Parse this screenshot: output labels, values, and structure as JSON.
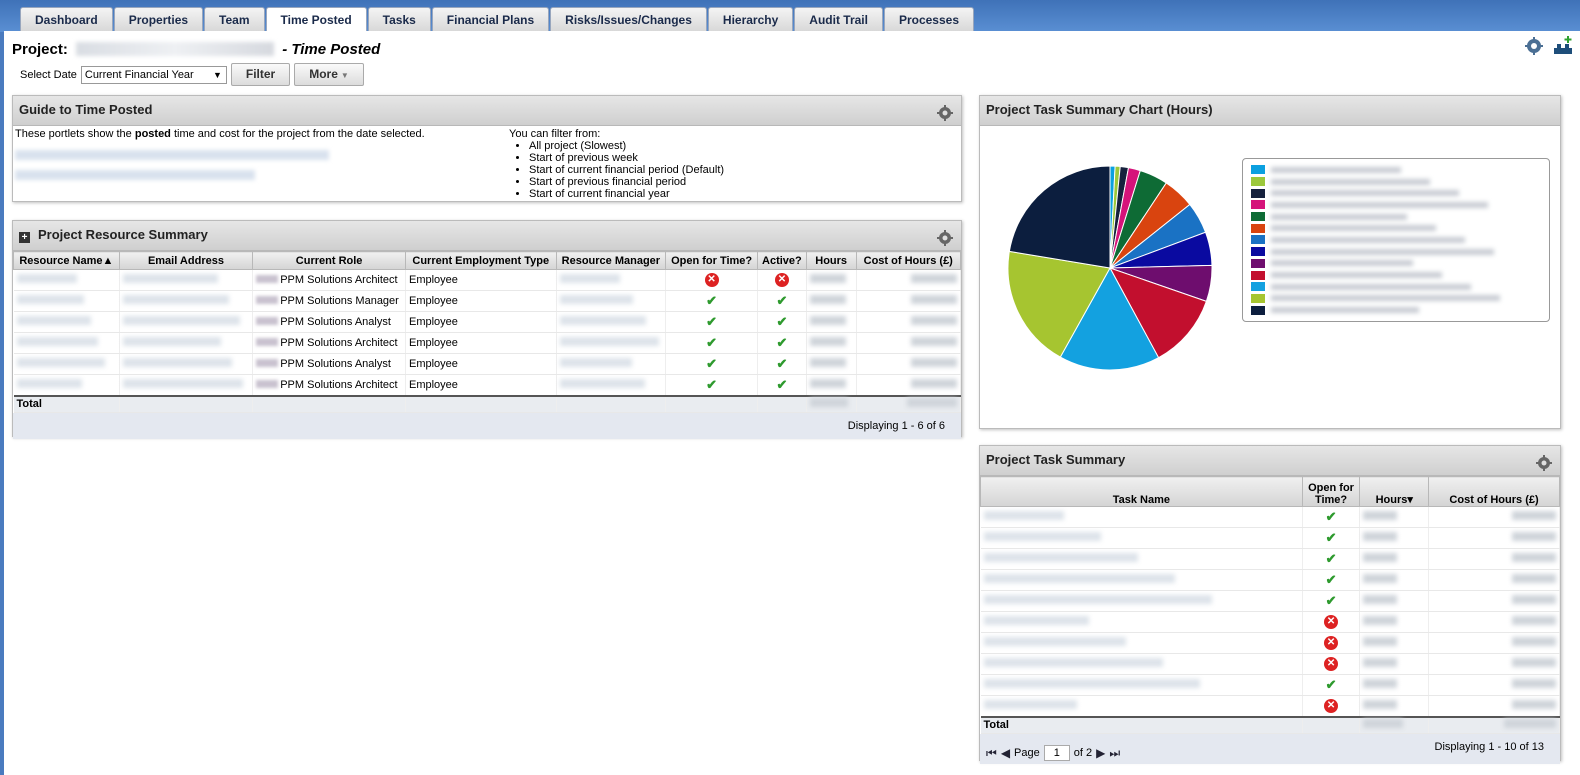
{
  "tabs": [
    "Dashboard",
    "Properties",
    "Team",
    "Time Posted",
    "Tasks",
    "Financial Plans",
    "Risks/Issues/Changes",
    "Hierarchy",
    "Audit Trail",
    "Processes"
  ],
  "header": {
    "project_label": "Project:",
    "page_name": "- Time Posted"
  },
  "filter": {
    "label": "Select Date",
    "selected": "Current Financial Year",
    "filter_button": "Filter",
    "more_button": "More"
  },
  "guide": {
    "title": "Guide to Time Posted",
    "text_prefix": "These portlets show the ",
    "text_bold": "posted",
    "text_suffix": " time and cost for the project from the date selected.",
    "filter_heading": "You can filter from:",
    "options": [
      "All project (Slowest)",
      "Start of previous week",
      "Start of current financial period (Default)",
      "Start of previous financial period",
      "Start of current financial year"
    ]
  },
  "resource": {
    "title": "Project Resource Summary",
    "columns": [
      "Resource Name▲",
      "Email Address",
      "Current Role",
      "Current Employment Type",
      "Resource Manager",
      "Open for Time?",
      "Active?",
      "Hours",
      "Cost of Hours (£)"
    ],
    "rows": [
      {
        "role": "PPM Solutions Architect",
        "type": "Employee",
        "open": false,
        "active": false
      },
      {
        "role": "PPM Solutions Manager",
        "type": "Employee",
        "open": true,
        "active": true
      },
      {
        "role": "PPM Solutions Analyst",
        "type": "Employee",
        "open": true,
        "active": true
      },
      {
        "role": "PPM Solutions Architect",
        "type": "Employee",
        "open": true,
        "active": true
      },
      {
        "role": "PPM Solutions Analyst",
        "type": "Employee",
        "open": true,
        "active": true
      },
      {
        "role": "PPM Solutions Architect",
        "type": "Employee",
        "open": true,
        "active": true
      }
    ],
    "total_label": "Total",
    "displaying": "Displaying 1 - 6 of 6"
  },
  "chart": {
    "title": "Project Task Summary Chart (Hours)",
    "colors": {
      "accent": "#4a7bbf"
    }
  },
  "chart_data": {
    "type": "pie",
    "series": [
      {
        "values": [
          0.8,
          0.8,
          1.3,
          1.9,
          4.5,
          5.0,
          5.0,
          5.3,
          5.7,
          11.8,
          16.0,
          19.5,
          22.4
        ],
        "colors": [
          "#0ba0e0",
          "#9cc83b",
          "#16213d",
          "#d5137a",
          "#0e6b35",
          "#d9440f",
          "#1a72c4",
          "#0a0aa0",
          "#6e0d6e",
          "#c20f2e",
          "#13a1e0",
          "#a6c530",
          "#0c1e3e"
        ]
      }
    ]
  },
  "tasks": {
    "title": "Project Task Summary",
    "columns": [
      "Task Name",
      "Open for Time?",
      "Hours▾",
      "Cost of Hours (£)"
    ],
    "open": [
      true,
      true,
      true,
      true,
      true,
      false,
      false,
      false,
      true,
      false
    ],
    "total_label": "Total",
    "page_label": "Page",
    "page_value": "1",
    "page_of": "of 2",
    "displaying": "Displaying 1 - 10 of 13"
  }
}
